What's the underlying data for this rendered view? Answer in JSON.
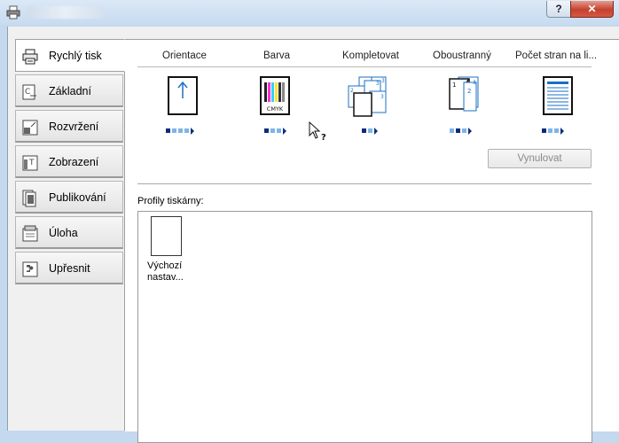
{
  "window": {
    "title": "",
    "help_label": "?",
    "close_label": "✕"
  },
  "tabs": [
    {
      "label": "Rychlý tisk",
      "icon": "printer-icon",
      "active": true
    },
    {
      "label": "Základní",
      "icon": "basic-page-icon",
      "active": false
    },
    {
      "label": "Rozvržení",
      "icon": "layout-icon",
      "active": false
    },
    {
      "label": "Zobrazení",
      "icon": "imaging-icon",
      "active": false
    },
    {
      "label": "Publikování",
      "icon": "publishing-icon",
      "active": false
    },
    {
      "label": "Úloha",
      "icon": "job-icon",
      "active": false
    },
    {
      "label": "Upřesnit",
      "icon": "advanced-puzzle-icon",
      "active": false
    }
  ],
  "quick_print": {
    "columns": [
      {
        "label": "Orientace",
        "icon": "portrait-orientation-icon",
        "selected_index": 0,
        "options": 4
      },
      {
        "label": "Barva",
        "icon": "color-cmyk-icon",
        "selected_index": 0,
        "options": 3
      },
      {
        "label": "Kompletovat",
        "icon": "collate-icon",
        "selected_index": 0,
        "options": 2
      },
      {
        "label": "Oboustranný",
        "icon": "duplex-icon",
        "selected_index": 1,
        "options": 3
      },
      {
        "label": "Počet stran na li...",
        "icon": "pages-per-sheet-icon",
        "selected_index": 0,
        "options": 3
      }
    ],
    "cmyk_text": "CMYK",
    "reset_label": "Vynulovat"
  },
  "profiles": {
    "label": "Profily tiskárny:",
    "items": [
      {
        "name_line1": "Výchozí",
        "name_line2": "nastav..."
      }
    ]
  },
  "colors": {
    "accent_blue": "#1a6fc4",
    "dot_dark": "#0a2d7a",
    "dot_light": "#7fb4e6"
  }
}
